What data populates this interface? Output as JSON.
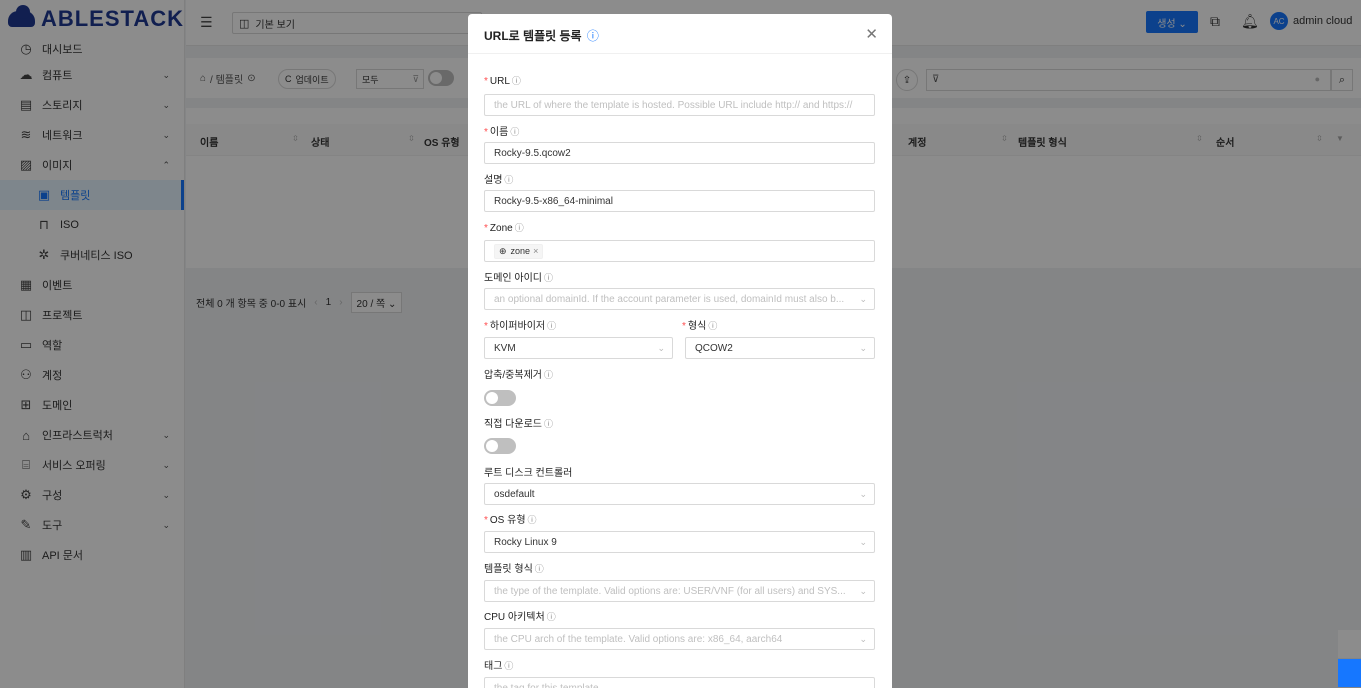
{
  "brand": "ABLESTACK",
  "sidebar": {
    "items": [
      {
        "label": "대시보드",
        "icon": "◷",
        "chevron": ""
      },
      {
        "label": "컴퓨트",
        "icon": "☁",
        "chevron": "⌄"
      },
      {
        "label": "스토리지",
        "icon": "▤",
        "chevron": "⌄"
      },
      {
        "label": "네트워크",
        "icon": "≋",
        "chevron": "⌄"
      },
      {
        "label": "이미지",
        "icon": "▨",
        "chevron": "⌃"
      },
      {
        "label": "템플릿",
        "icon": "▣",
        "chevron": ""
      },
      {
        "label": "ISO",
        "icon": "⊓",
        "chevron": ""
      },
      {
        "label": "쿠버네티스 ISO",
        "icon": "✲",
        "chevron": ""
      },
      {
        "label": "이벤트",
        "icon": "▦",
        "chevron": ""
      },
      {
        "label": "프로젝트",
        "icon": "◫",
        "chevron": ""
      },
      {
        "label": "역할",
        "icon": "▭",
        "chevron": ""
      },
      {
        "label": "계정",
        "icon": "⚇",
        "chevron": ""
      },
      {
        "label": "도메인",
        "icon": "⊞",
        "chevron": ""
      },
      {
        "label": "인프라스트럭처",
        "icon": "⌂",
        "chevron": "⌄"
      },
      {
        "label": "서비스 오퍼링",
        "icon": "⌸",
        "chevron": "⌄"
      },
      {
        "label": "구성",
        "icon": "⚙",
        "chevron": "⌄"
      },
      {
        "label": "도구",
        "icon": "✎",
        "chevron": "⌄"
      },
      {
        "label": "API 문서",
        "icon": "▥",
        "chevron": ""
      }
    ]
  },
  "topbar": {
    "view_label": "기본 보기",
    "create_label": "생성 ⌄",
    "avatar_text": "AC",
    "user_name": "admin cloud"
  },
  "toolbar": {
    "breadcrumb": "/ 템플릿",
    "refresh_label": "업데이트",
    "filter_value": "모두"
  },
  "table": {
    "headers": [
      "이름",
      "상태",
      "OS 유형",
      "계정",
      "템플릿 형식",
      "순서"
    ]
  },
  "pagination": {
    "summary": "전체 0 개 항목 중 0-0 표시",
    "page": "1",
    "page_size": "20 / 쪽 ⌄"
  },
  "modal": {
    "title": "URL로 템플릿 등록",
    "url_label": "URL",
    "url_placeholder": "the URL of where the template is hosted. Possible URL include http:// and https://",
    "name_label": "이름",
    "name_value": "Rocky-9.5.qcow2",
    "desc_label": "설명",
    "desc_value": "Rocky-9.5-x86_64-minimal",
    "zone_label": "Zone",
    "zone_tag": "zone",
    "domain_label": "도메인 아이디",
    "domain_placeholder": "an optional domainId. If the account parameter is used, domainId must also b...",
    "hypervisor_label": "하이퍼바이저",
    "hypervisor_value": "KVM",
    "format_label": "형식",
    "format_value": "QCOW2",
    "compress_label": "압축/중복제거",
    "direct_download_label": "직접 다운로드",
    "root_disk_label": "루트 디스크 컨트롤러",
    "root_disk_value": "osdefault",
    "os_type_label": "OS 유형",
    "os_type_value": "Rocky Linux 9",
    "template_type_label": "템플릿 형식",
    "template_type_placeholder": "the type of the template. Valid options are: USER/VNF (for all users) and SYS...",
    "cpu_arch_label": "CPU 아키텍처",
    "cpu_arch_placeholder": "the CPU arch of the template. Valid options are: x86_64, aarch64",
    "tag_label": "태그",
    "tag_placeholder": "the tag for this template"
  },
  "colors": {
    "primary": "#1677ff",
    "brand": "#1f3a93",
    "required": "#ff4d4f"
  }
}
